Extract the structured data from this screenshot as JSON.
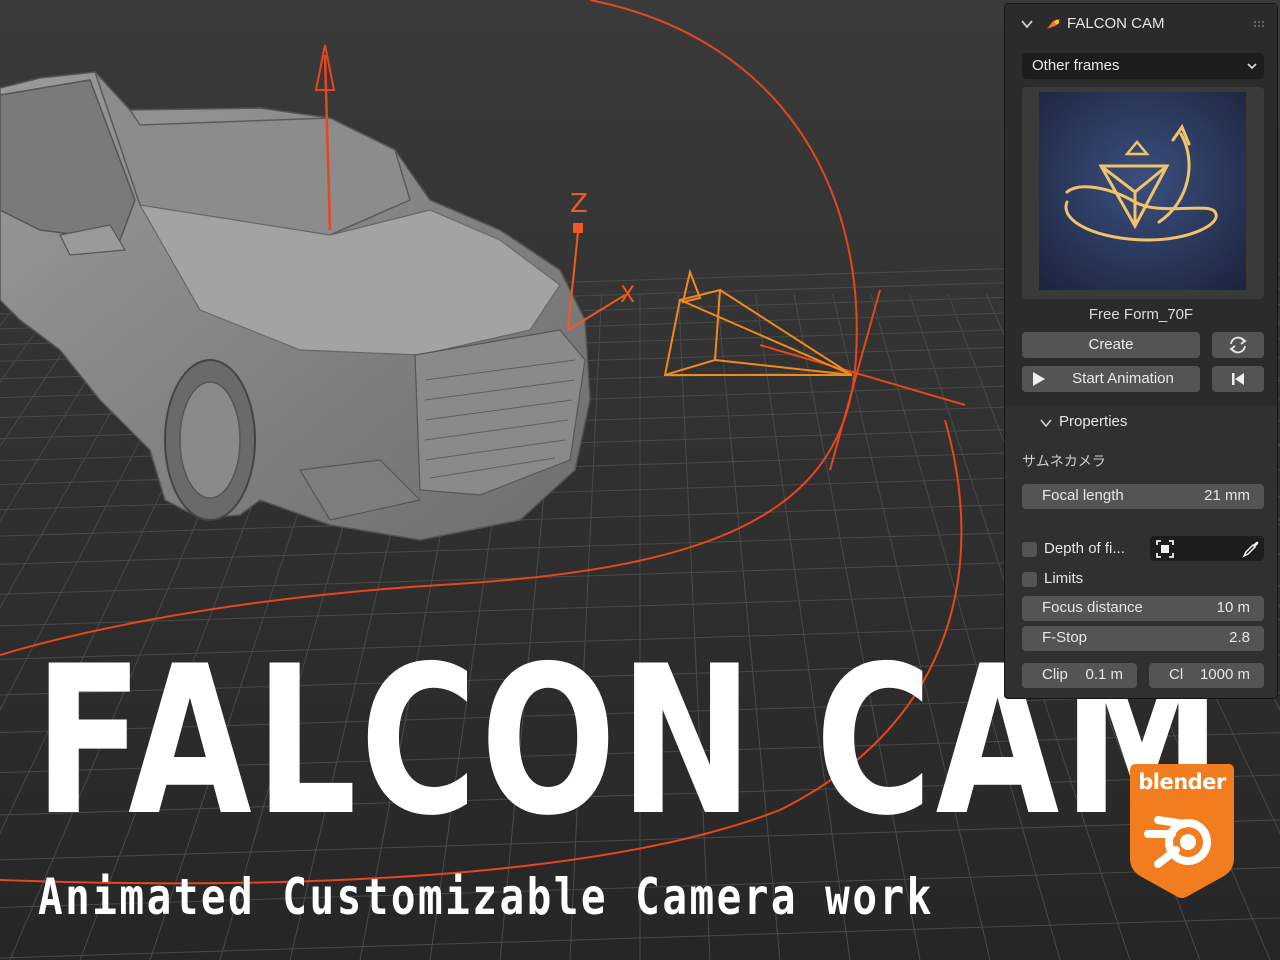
{
  "hero": {
    "title": "FALCON CAM",
    "subtitle": "Animated Customizable Camera work"
  },
  "viewport": {
    "gizmo_axis_z": "Z",
    "gizmo_axis_x": "X",
    "colors": {
      "background": "#2e2e2e",
      "grid": "#4a4a4a",
      "path": "#e8461e",
      "camera": "#f08a1a"
    }
  },
  "badge": {
    "text": "blender",
    "icon": "blender-logo-icon",
    "color": "#f27d1e"
  },
  "panel": {
    "header": {
      "title": "FALCON CAM",
      "collapse_icon": "chevron-down-icon",
      "addon_icon": "falcon-cam-icon",
      "grip_icon": "drag-grip-icon"
    },
    "preset_dropdown": {
      "value": "Other frames",
      "icon": "chevron-down-icon"
    },
    "preview": {
      "label": "Free Form_70F",
      "thumbnail": "camera-path-preview-icon"
    },
    "buttons": {
      "create": "Create",
      "refresh_icon": "refresh-icon",
      "start_animation": "Start Animation",
      "play_icon": "play-icon",
      "rewind_icon": "jump-to-start-icon"
    },
    "properties": {
      "section_label": "Properties",
      "thumbnail_camera_label": "サムネカメラ",
      "focal_length": {
        "label": "Focal length",
        "value": "21 mm"
      },
      "depth_of_field": {
        "label": "Depth of fi...",
        "checked": false,
        "focus_object_icon": "focus-target-icon",
        "eyedropper_icon": "eyedropper-icon"
      },
      "limits": {
        "label": "Limits",
        "checked": false
      },
      "focus_distance": {
        "label": "Focus distance",
        "value": "10 m"
      },
      "f_stop": {
        "label": "F-Stop",
        "value": "2.8"
      },
      "clip_start": {
        "label": "Clip",
        "value": "0.1 m"
      },
      "clip_end": {
        "label": "Cl",
        "value": "1000 m"
      }
    }
  }
}
